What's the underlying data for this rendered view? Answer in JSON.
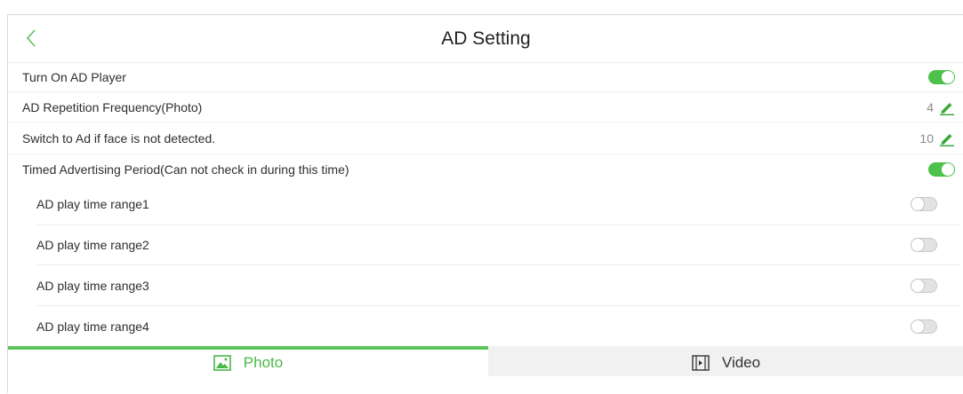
{
  "header": {
    "title": "AD Setting"
  },
  "settings": [
    {
      "label": "Turn On AD Player",
      "control": "toggle",
      "state": "on"
    },
    {
      "label": "AD Repetition Frequency(Photo)",
      "control": "edit",
      "value": "4"
    },
    {
      "label": "Switch to Ad if face is not detected.",
      "control": "edit",
      "value": "10"
    },
    {
      "label": "Timed Advertising Period(Can not check in during this time)",
      "control": "toggle",
      "state": "on"
    }
  ],
  "time_ranges": [
    {
      "label": "AD play time range1",
      "state": "off"
    },
    {
      "label": "AD play time range2",
      "state": "off"
    },
    {
      "label": "AD play time range3",
      "state": "off"
    },
    {
      "label": "AD play time range4",
      "state": "off"
    }
  ],
  "tabs": [
    {
      "label": "Photo",
      "icon": "image-icon",
      "active": true
    },
    {
      "label": "Video",
      "icon": "film-icon",
      "active": false
    }
  ],
  "colors": {
    "accent": "#4cc24a",
    "edit_icon": "#3aa83a",
    "inactive_tab_bg": "#f1f1f1"
  }
}
